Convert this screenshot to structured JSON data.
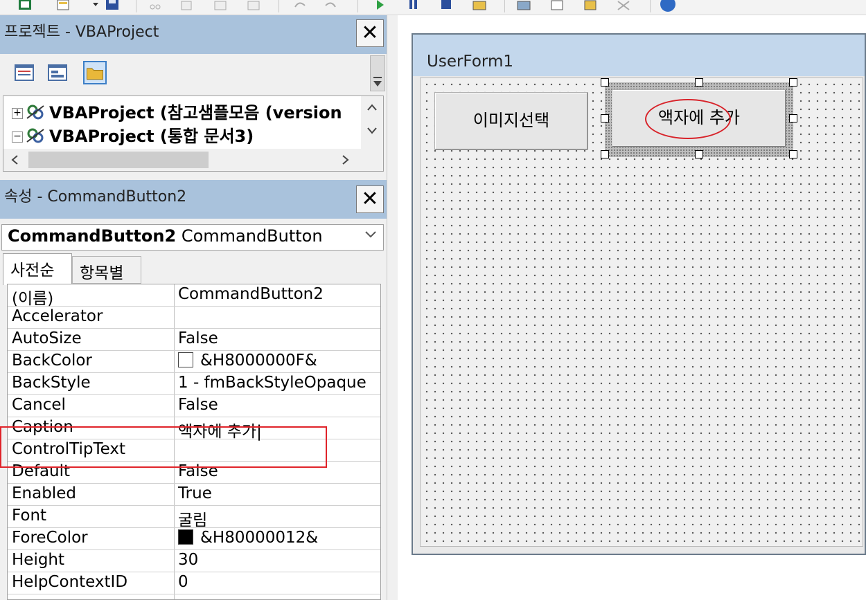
{
  "project_pane": {
    "title": "프로젝트 - VBAProject",
    "close_glyph": "✕",
    "tree": [
      {
        "expander": "+",
        "label": "VBAProject (참고샘플모음 (version"
      },
      {
        "expander": "−",
        "label": "VBAProject (통합 문서3)"
      }
    ]
  },
  "properties_pane": {
    "title": "속성 - CommandButton2",
    "close_glyph": "✕",
    "object_combo": {
      "name": "CommandButton2",
      "type": "CommandButton"
    },
    "tabs": [
      "사전순",
      "항목별"
    ],
    "rows": [
      {
        "name": "(이름)",
        "value": "CommandButton2"
      },
      {
        "name": "Accelerator",
        "value": ""
      },
      {
        "name": "AutoSize",
        "value": "False"
      },
      {
        "name": "BackColor",
        "value": "&H8000000F&"
      },
      {
        "name": "BackStyle",
        "value": "1 - fmBackStyleOpaque"
      },
      {
        "name": "Cancel",
        "value": "False"
      },
      {
        "name": "Caption",
        "value": "액자에 추가|"
      },
      {
        "name": "ControlTipText",
        "value": ""
      },
      {
        "name": "Default",
        "value": "False"
      },
      {
        "name": "Enabled",
        "value": "True"
      },
      {
        "name": "Font",
        "value": "굴림"
      },
      {
        "name": "ForeColor",
        "value": "&H80000012&"
      },
      {
        "name": "Height",
        "value": "30"
      },
      {
        "name": "HelpContextID",
        "value": "0"
      }
    ]
  },
  "userform": {
    "title": "UserForm1",
    "buttons": [
      "이미지선택",
      "액자에 추가"
    ]
  },
  "colors": {
    "title_bar": "#a9c2dc",
    "form_title": "#c3d7ec",
    "highlight_red": "#e0232a",
    "backcolor_swatch": "#ffffff",
    "forecolor_swatch": "#000000"
  }
}
